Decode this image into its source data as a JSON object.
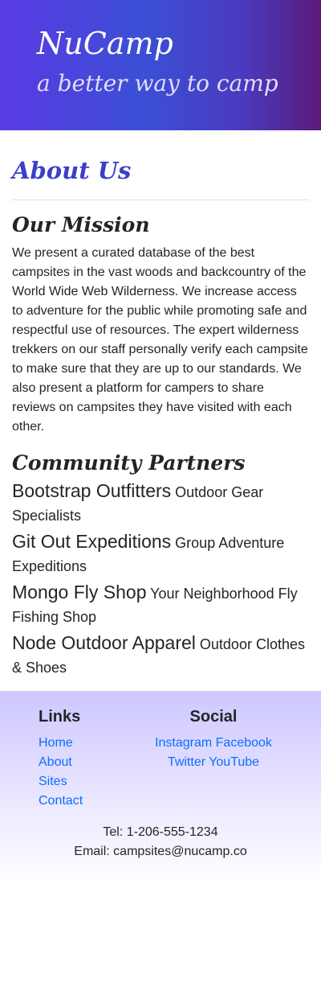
{
  "header": {
    "brand": "NuCamp",
    "tagline": "a better way to camp"
  },
  "main": {
    "title": "About Us",
    "mission": {
      "heading": "Our Mission",
      "text": "We present a curated database of the best campsites in the vast woods and backcountry of the World Wide Web Wilderness. We increase access to adventure for the public while promoting safe and respectful use of resources. The expert wilderness trekkers on our staff personally verify each campsite to make sure that they are up to our standards. We also present a platform for campers to share reviews on campsites they have visited with each other."
    },
    "partners": {
      "heading": "Community Partners",
      "items": [
        {
          "name": "Bootstrap Outfitters",
          "desc": "Outdoor Gear Specialists"
        },
        {
          "name": "Git Out Expeditions",
          "desc": "Group Adventure Expeditions"
        },
        {
          "name": "Mongo Fly Shop",
          "desc": "Your Neighborhood Fly Fishing Shop"
        },
        {
          "name": "Node Outdoor Apparel",
          "desc": "Outdoor Clothes & Shoes"
        }
      ]
    }
  },
  "footer": {
    "links": {
      "heading": "Links",
      "items": [
        "Home",
        "About",
        "Sites",
        "Contact"
      ]
    },
    "social": {
      "heading": "Social",
      "items": [
        "Instagram",
        "Facebook",
        "Twitter",
        "YouTube"
      ]
    },
    "contact": {
      "tel": "Tel: 1-206-555-1234",
      "email": "Email: campsites@nucamp.co"
    }
  }
}
